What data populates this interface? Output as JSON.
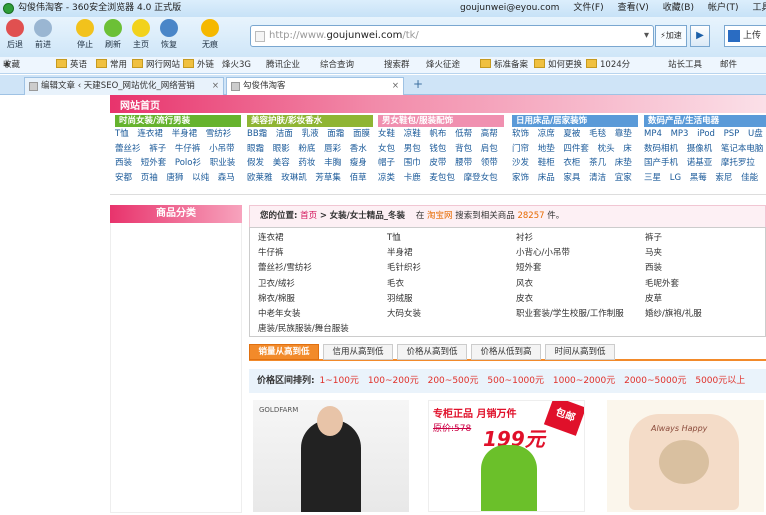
{
  "window": {
    "title": "勾俊伟淘客 - 360安全浏览器 4.0 正式版",
    "account": "goujunwei@eyou.com",
    "menu": [
      "文件(F)",
      "查看(V)",
      "收藏(B)",
      "帐户(T)",
      "工具(T)"
    ]
  },
  "toolbar": {
    "buttons": [
      "后退",
      "前进",
      "停止",
      "刷新",
      "主页",
      "恢复",
      "无痕"
    ],
    "address_prefix": "http://www.",
    "address_domain": "goujunwei.com",
    "address_suffix": "/tk/",
    "speed_label": "加速",
    "search_label": "上传"
  },
  "favbar": {
    "items": [
      "收藏",
      "英语",
      "常用",
      "网行网站",
      "外链",
      "烽火3G",
      "腾讯企业",
      "综合查询",
      "搜索群",
      "烽火征途",
      "标准备案",
      "如何更换",
      "1024分",
      "站长工具",
      "邮件"
    ]
  },
  "tabs": [
    {
      "label": "编辑文章 ‹ 天建SEO_网站优化_网络营销"
    },
    {
      "label": "勾俊伟淘客"
    }
  ],
  "site": {
    "home": "网站首页"
  },
  "categories": [
    {
      "header": "时尚女装/流行男装",
      "color": "#66b32e",
      "rows": [
        "T恤 连衣裙 半身裙 雪纺衫",
        "蕾丝衫 裤子 牛仔裤 小吊带",
        "西装 短外套 Polo衫 职业装",
        "安都 页袖 唐狮 以纯 森马"
      ]
    },
    {
      "header": "美容护肤/彩妆香水",
      "color": "#8fb534",
      "rows": [
        "BB霜 洁面 乳液 面霜 面膜",
        "眼霜 眼影 粉底 唇彩 香水",
        "假发 美容 药妆 丰胸 瘦身",
        "欧莱雅 玫琳凯 芳草集 佰草"
      ]
    },
    {
      "header": "男女鞋包/服装配饰",
      "color": "#f090b0",
      "rows": [
        "女鞋 凉鞋 帆布 低帮 高帮",
        "女包 男包 钱包 背包 肩包",
        "帽子 围巾 皮带 腰带 领带",
        "凉类 卡鹿 麦包包 摩登女包"
      ]
    },
    {
      "header": "日用床品/居家装饰",
      "color": "#5a9ad8",
      "rows": [
        "软饰 凉席 夏被 毛毯 靠垫",
        "门帘 地垫 四件套 枕头 床",
        "沙发 鞋柜 衣柜 茶几 床垫",
        "家饰 床品 家具 清洁 宜家"
      ]
    },
    {
      "header": "数码产品/生活电器",
      "color": "#5a9ad8",
      "rows": [
        "MP4 MP3 iPod PSP U盘",
        "数码相机 摄像机 笔记本电脑",
        "国产手机 诺基亚 摩托罗拉",
        "三星 LG 黑莓 索尼 佳能"
      ]
    }
  ],
  "sidebar": {
    "header": "商品分类"
  },
  "location": {
    "label": "您的位置:",
    "home": "首页",
    "sep": ">",
    "path": "女装/女士精品_冬装",
    "mid": "在",
    "shop": "淘宝网",
    "mid2": "搜索到相关商品",
    "count": "28257",
    "unit": "件。"
  },
  "subcats": [
    [
      "连衣裙",
      "牛仔裤",
      "蕾丝衫/雪纺衫",
      "卫衣/绒衫",
      "棉衣/棉服",
      "中老年女装",
      "唐装/民族服装/舞台服装"
    ],
    [
      "T恤",
      "半身裙",
      "毛针织衫",
      "毛衣",
      "羽绒服",
      "大码女装"
    ],
    [
      "衬衫",
      "小背心/小吊带",
      "短外套",
      "风衣",
      "皮衣",
      "职业套装/学生校服/工作制服"
    ],
    [
      "裤子",
      "马夹",
      "西装",
      "毛呢外套",
      "皮草",
      "婚纱/旗袍/礼服"
    ]
  ],
  "sort": {
    "tabs": [
      "销量从高到低",
      "信用从高到低",
      "价格从高到低",
      "价格从低到高",
      "时间从高到低"
    ],
    "active": 0
  },
  "price": {
    "label": "价格区间排列:",
    "ranges": [
      "1~100元",
      "100~200元",
      "200~500元",
      "500~1000元",
      "1000~2000元",
      "2000~5000元",
      "5000元以上"
    ]
  },
  "products": {
    "p1_brand": "GOLDFARM",
    "p2_line1": "专柜正品 月销万件",
    "p2_line2": "原价:578",
    "p2_price": "199元",
    "p2_tag": "包邮",
    "p3_text": "Always Happy"
  }
}
